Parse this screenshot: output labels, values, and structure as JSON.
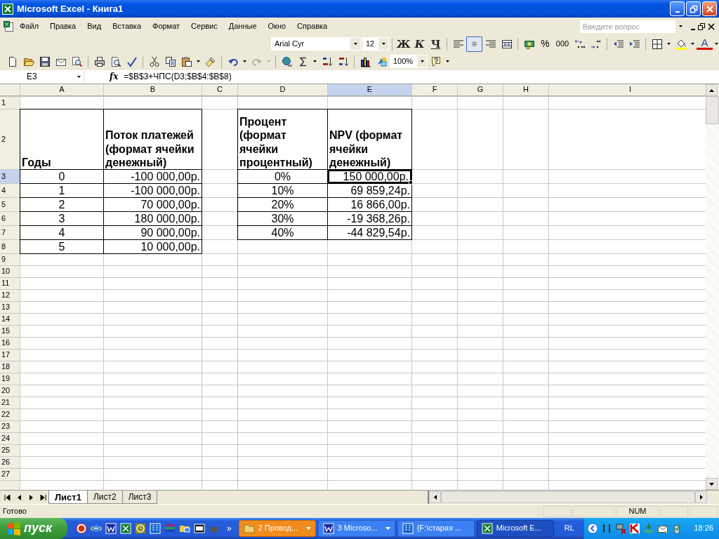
{
  "window": {
    "title": "Microsoft Excel - Книга1"
  },
  "menu": [
    "Файл",
    "Правка",
    "Вид",
    "Вставка",
    "Формат",
    "Сервис",
    "Данные",
    "Окно",
    "Справка"
  ],
  "help_search": {
    "placeholder": "Введите вопрос"
  },
  "formatting": {
    "font": "Arial Cyr",
    "size": "12",
    "bold": "Ж",
    "italic": "К",
    "underline": "Ч",
    "align_buttons": [
      {
        "kind": "left",
        "selected": false
      },
      {
        "kind": "center",
        "selected": true
      },
      {
        "kind": "right",
        "selected": false
      }
    ],
    "percent": "%",
    "thousands": "000",
    "font_color": "A"
  },
  "standard": {
    "zoom": "100%"
  },
  "formula_bar": {
    "name_box": "E3",
    "function_label": "fx",
    "formula": "=$B$3+ЧПС(D3;$B$4:$B$8)"
  },
  "sheet": {
    "columns": [
      {
        "label": "A",
        "kind": "center",
        "selected": false
      },
      {
        "label": "B",
        "kind": "right",
        "selected": false
      },
      {
        "label": "C",
        "selected": false
      },
      {
        "label": "D",
        "kind": "center",
        "selected": false
      },
      {
        "label": "E",
        "kind": "right",
        "selected": true
      },
      {
        "label": "F",
        "selected": false
      },
      {
        "label": "G",
        "selected": false
      },
      {
        "label": "H",
        "selected": false
      },
      {
        "label": "I",
        "selected": false
      }
    ],
    "rows": [
      {
        "number": "1",
        "selected": false
      },
      {
        "number": "2",
        "selected": false,
        "kind": "header",
        "cells": {
          "A": {
            "text": "Годы",
            "selected": false
          },
          "B": {
            "text": "Поток платежей (формат ячейки денежный)",
            "selected": false
          },
          "D": {
            "text": "Процент (формат ячейки процентный)",
            "selected": false
          },
          "E": {
            "text": "NPV (формат ячейки денежный)",
            "selected": false
          }
        }
      },
      {
        "number": "3",
        "selected": true,
        "cells": {
          "A": {
            "text": "0",
            "selected": false
          },
          "B": {
            "text": "-100 000,00р.",
            "selected": false
          },
          "D": {
            "text": "0%",
            "selected": false
          },
          "E": {
            "text": "150 000,00р.",
            "selected": true
          }
        }
      },
      {
        "number": "4",
        "selected": false,
        "cells": {
          "A": {
            "text": "1",
            "selected": false
          },
          "B": {
            "text": "-100 000,00р.",
            "selected": false
          },
          "D": {
            "text": "10%",
            "selected": false
          },
          "E": {
            "text": "69 859,24р.",
            "selected": false
          }
        }
      },
      {
        "number": "5",
        "selected": false,
        "cells": {
          "A": {
            "text": "2",
            "selected": false
          },
          "B": {
            "text": "70 000,00р.",
            "selected": false
          },
          "D": {
            "text": "20%",
            "selected": false
          },
          "E": {
            "text": "16 866,00р.",
            "selected": false
          }
        }
      },
      {
        "number": "6",
        "selected": false,
        "cells": {
          "A": {
            "text": "3",
            "selected": false
          },
          "B": {
            "text": "180 000,00р.",
            "selected": false
          },
          "D": {
            "text": "30%",
            "selected": false
          },
          "E": {
            "text": "-19 368,26р.",
            "selected": false
          }
        }
      },
      {
        "number": "7",
        "selected": false,
        "cells": {
          "A": {
            "text": "4",
            "selected": false
          },
          "B": {
            "text": "90 000,00р.",
            "selected": false
          },
          "D": {
            "text": "40%",
            "selected": false
          },
          "E": {
            "text": "-44 829,54р.",
            "selected": false
          }
        }
      },
      {
        "number": "8",
        "selected": false,
        "cells": {
          "A": {
            "text": "5",
            "selected": false
          },
          "B": {
            "text": "10 000,00р.",
            "selected": false
          }
        }
      },
      {
        "number": "9",
        "selected": false
      },
      {
        "number": "10",
        "selected": false
      },
      {
        "number": "11",
        "selected": false
      },
      {
        "number": "12",
        "selected": false
      },
      {
        "number": "13",
        "selected": false
      },
      {
        "number": "14",
        "selected": false
      },
      {
        "number": "15",
        "selected": false
      },
      {
        "number": "16",
        "selected": false
      },
      {
        "number": "17",
        "selected": false
      },
      {
        "number": "18",
        "selected": false
      },
      {
        "number": "19",
        "selected": false
      },
      {
        "number": "20",
        "selected": false
      },
      {
        "number": "21",
        "selected": false
      },
      {
        "number": "22",
        "selected": false
      },
      {
        "number": "23",
        "selected": false
      },
      {
        "number": "24",
        "selected": false
      },
      {
        "number": "25",
        "selected": false
      },
      {
        "number": "26",
        "selected": false
      },
      {
        "number": "27",
        "selected": false
      }
    ]
  },
  "sheet_tabs": [
    {
      "label": "Лист1",
      "selected": true
    },
    {
      "label": "Лист2",
      "selected": false
    },
    {
      "label": "Лист3",
      "selected": false
    }
  ],
  "status_bar": {
    "text": "Готово",
    "indicators": [
      "NUM"
    ]
  },
  "taskbar": {
    "start": "пуск",
    "chevron": "»",
    "tasks": [
      {
        "label": "2 Провод...",
        "kind": "folder",
        "grouped": true,
        "flashing": true,
        "selected": false
      },
      {
        "label": "3 Microso...",
        "kind": "word",
        "grouped": true,
        "flashing": false,
        "selected": false
      },
      {
        "label": "{F:\\старая ...",
        "kind": "book",
        "grouped": false,
        "flashing": false,
        "selected": false
      },
      {
        "label": "Microsoft E...",
        "kind": "excel",
        "grouped": false,
        "flashing": false,
        "selected": true
      }
    ],
    "language": "RL",
    "clock": "18:26"
  }
}
